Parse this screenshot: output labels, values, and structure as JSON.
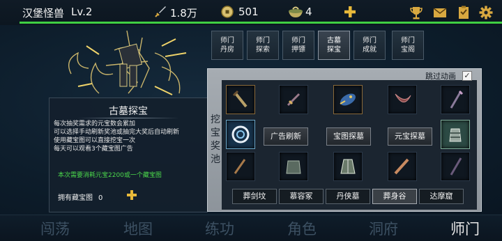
{
  "header": {
    "player_name": "汉堡怪兽",
    "level": "Lv.2",
    "power": "1.8万",
    "coins": "501",
    "bowls": "4",
    "power_icon": "sword-icon",
    "coin_icon": "coin-icon",
    "bowl_icon": "bowl-icon",
    "add_icon": "plus-icon",
    "system_icons": [
      "trophy-icon",
      "mail-icon",
      "clipboard-icon",
      "gear-icon"
    ]
  },
  "tabs": [
    {
      "line1": "师门",
      "line2": "丹房"
    },
    {
      "line1": "师门",
      "line2": "探索"
    },
    {
      "line1": "师门",
      "line2": "押镖"
    },
    {
      "line1": "古墓",
      "line2": "探宝"
    },
    {
      "line1": "师门",
      "line2": "成就"
    },
    {
      "line1": "师门",
      "line2": "宝阁"
    }
  ],
  "info": {
    "title": "古墓探宝",
    "desc": [
      "每次抽奖需求的元宝数会累加",
      "可以选择手动刷新奖池或抽完大奖后自动刷新",
      "使用藏宝图可以直接挖宝一次",
      "每天可以观看3个藏宝图广告"
    ],
    "cost": "本次需要消耗元宝2200或一个藏宝图",
    "own_label": "拥有藏宝图",
    "own_value": "0"
  },
  "treasure": {
    "side_label": [
      "挖",
      "宝",
      "奖",
      "池"
    ],
    "skip_label": "跳过动画",
    "skip_checked": "✓",
    "buttons": {
      "ad_refresh": "广告刷新",
      "map_dig": "宝图探墓",
      "gold_dig": "元宝探墓"
    },
    "tombs": [
      "葬剑坟",
      "慕容冢",
      "丹侠墓",
      "葬身谷",
      "达摩窟"
    ],
    "active_tomb": "葬身谷"
  },
  "colors": {
    "progress": "#3fcf43",
    "cost_text": "#4bd84b",
    "accent_gold": "#e8b93a"
  },
  "bottom_nav": [
    "闯荡",
    "地图",
    "练功",
    "角色",
    "洞府",
    "师门"
  ],
  "bottom_nav_active": "师门"
}
